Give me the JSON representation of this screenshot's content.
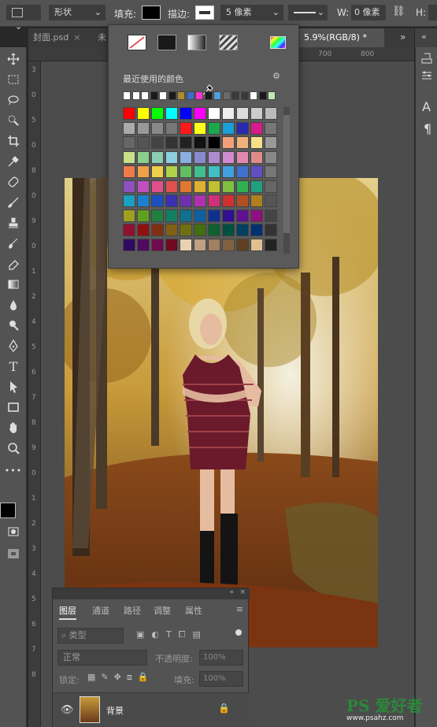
{
  "options_bar": {
    "mode_label": "形状",
    "fill_label": "填充:",
    "stroke_label": "描边:",
    "stroke_size": "5 像素",
    "width_label": "W:",
    "width_value": "0 像素",
    "height_label": "H:"
  },
  "tabs": [
    {
      "label": "封面.psd",
      "active": false
    },
    {
      "label": "未",
      "active": false
    },
    {
      "label": "5.9%(RGB/8) *",
      "active": true
    }
  ],
  "ruler": {
    "h_ticks": [
      "700",
      "800"
    ],
    "v_ticks": [
      "3",
      "0",
      "5",
      "0",
      "8",
      "0",
      "9",
      "0",
      "1",
      "2",
      "4",
      "5",
      "6",
      "7",
      "8",
      "9",
      "0",
      "1",
      "2",
      "3",
      "4",
      "5",
      "6",
      "7",
      "8"
    ]
  },
  "color_popup": {
    "recent_label": "最近使用的颜色",
    "recent_colors": [
      "#ffffff",
      "#ffffff",
      "#ffffff",
      "#1a1a1a",
      "#ffffff",
      "#1a1a1a",
      "#b08a2e",
      "#3c6ec8",
      "#ff33cc",
      "#1a1a1a",
      "#4f9fd8",
      "#6b6b6b",
      "#3a3a3a",
      "#3a3a3a",
      "#ffffff",
      "#1a1a1a",
      "#c4e8b4"
    ],
    "grid": [
      [
        "#ff0000",
        "#ffff00",
        "#00ff00",
        "#00ffff",
        "#0000ff",
        "#ff00ff",
        "#ffffff",
        "#eeeeee",
        "#dddddd",
        "#cccccc",
        "#bbbbbb"
      ],
      [
        "#aaaaaa",
        "#999999",
        "#888888",
        "#777777",
        "#ff1a1a",
        "#ffff1a",
        "#1aa84c",
        "#1a9fd8",
        "#2a2ab0",
        "#d81a8a",
        "#777777"
      ],
      [
        "#666666",
        "#555555",
        "#444444",
        "#333333",
        "#222222",
        "#111111",
        "#000000",
        "#f2a07a",
        "#f0b27a",
        "#f7e08a",
        "#999999"
      ],
      [
        "#c8e08a",
        "#8ad08a",
        "#8ad0b0",
        "#8ad0e0",
        "#8ab0e0",
        "#8a8ad0",
        "#b08ad0",
        "#d08ad0",
        "#e08ab0",
        "#e08a8a",
        "#888888"
      ],
      [
        "#f07a4a",
        "#f0a04a",
        "#f0d04a",
        "#b0d04a",
        "#60c060",
        "#40c090",
        "#40c0c0",
        "#40a0e0",
        "#4070d0",
        "#6050c0",
        "#777777"
      ],
      [
        "#9050c0",
        "#c050c0",
        "#e0508a",
        "#e05050",
        "#e07830",
        "#e0b030",
        "#c0c030",
        "#80c040",
        "#30b050",
        "#20a080",
        "#666666"
      ],
      [
        "#1aa0c0",
        "#1a80d0",
        "#1a50c0",
        "#3a30b0",
        "#7030b0",
        "#b030b0",
        "#d0307a",
        "#d03030",
        "#b05020",
        "#b08020",
        "#555555"
      ],
      [
        "#a0a020",
        "#60a020",
        "#208040",
        "#108060",
        "#107090",
        "#1060a0",
        "#103090",
        "#301090",
        "#601090",
        "#901080",
        "#444444"
      ],
      [
        "#901030",
        "#901010",
        "#803010",
        "#806010",
        "#707010",
        "#407010",
        "#106030",
        "#005040",
        "#004060",
        "#003070",
        "#333333"
      ],
      [
        "#300a60",
        "#500a60",
        "#700a50",
        "#700a20",
        "#ead2b0",
        "#c0a080",
        "#a08060",
        "#806040",
        "#604020",
        "#e0c090",
        "#222222"
      ]
    ]
  },
  "layers_panel": {
    "tabs": [
      "图层",
      "通道",
      "路径",
      "调整",
      "属性"
    ],
    "kind_label": "类型",
    "blend_mode": "正常",
    "opacity_label": "不透明度:",
    "opacity_value": "100%",
    "lock_label": "锁定:",
    "fill_label": "填充:",
    "fill_value": "100%",
    "layer_name": "背景"
  },
  "watermark": {
    "brand": "PS 爱好者",
    "url": "www.psahz.com"
  },
  "right_panel_labels": [
    "A",
    "¶"
  ]
}
